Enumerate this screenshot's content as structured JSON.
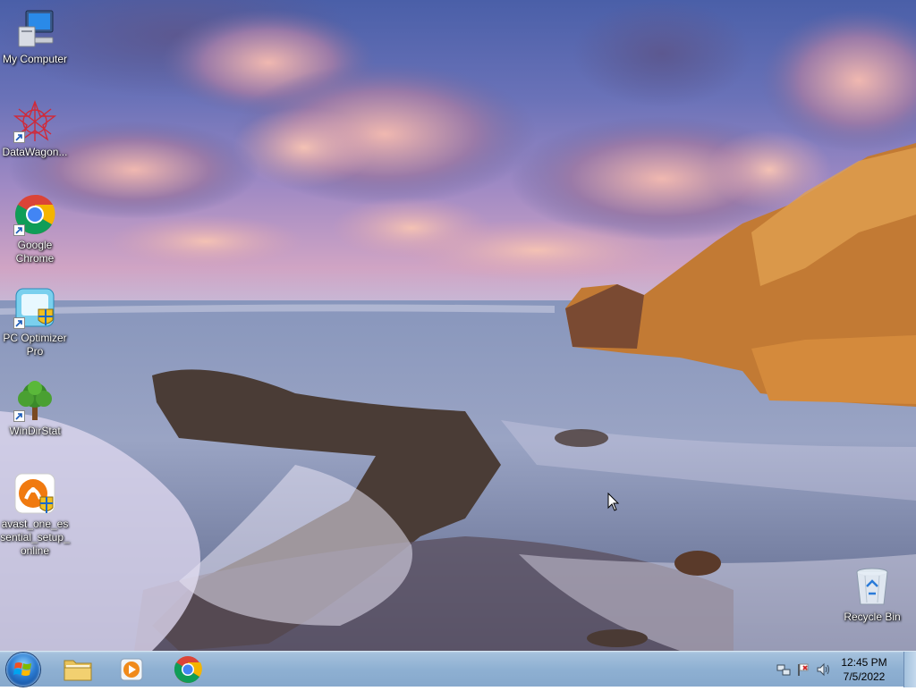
{
  "desktop_icons": [
    {
      "id": "my-computer",
      "label": "My Computer",
      "icon": "computer-icon"
    },
    {
      "id": "datawagon",
      "label": "DataWagon...",
      "icon": "datawagon-icon",
      "shortcut": true
    },
    {
      "id": "chrome",
      "label": "Google Chrome",
      "icon": "chrome-icon",
      "shortcut": true
    },
    {
      "id": "pc-optimizer",
      "label": "PC Optimizer Pro",
      "icon": "pc-optimizer-icon",
      "shortcut": true
    },
    {
      "id": "windirstat",
      "label": "WinDirStat",
      "icon": "tree-icon",
      "shortcut": true
    },
    {
      "id": "avast",
      "label": "avast_one_essential_setup_online",
      "icon": "avast-icon"
    },
    {
      "id": "recycle-bin",
      "label": "Recycle Bin",
      "icon": "recycle-bin-icon"
    }
  ],
  "taskbar": {
    "start_icon": "windows-logo-icon",
    "pinned": [
      {
        "name": "Windows Explorer",
        "icon": "folder-icon"
      },
      {
        "name": "Windows Media Player",
        "icon": "media-player-icon"
      },
      {
        "name": "Google Chrome",
        "icon": "chrome-icon"
      }
    ],
    "tray": {
      "icons": [
        "network-icon",
        "action-center-flag-icon",
        "volume-icon"
      ],
      "time": "12:45 PM",
      "date": "7/5/2022"
    }
  },
  "colors": {
    "taskbar": "#8eb0d2",
    "sky_top": "#4a5fa8",
    "rock": "#c07a2a"
  }
}
